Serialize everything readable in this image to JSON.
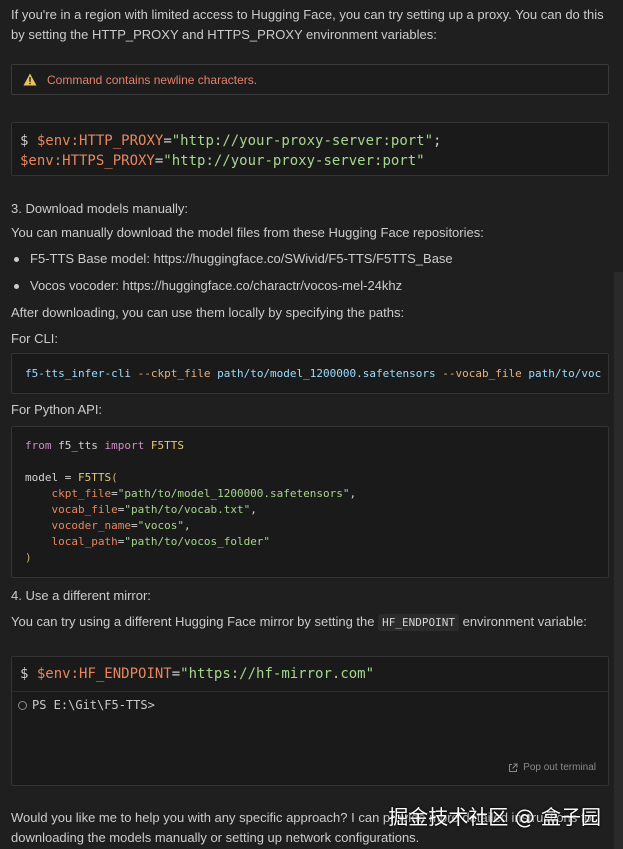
{
  "intro": "If you're in a region with limited access to Hugging Face, you can try setting up a proxy. You can do this by setting the HTTP_PROXY and HTTPS_PROXY environment variables:",
  "warning": {
    "icon": "warning-icon",
    "text": "Command contains newline characters."
  },
  "proxy_cmd": {
    "dollar": "$",
    "line1_var": "$env:HTTP_PROXY",
    "line1_eq": "=",
    "line1_str": "\"http://your-proxy-server:port\"",
    "line1_end": ";",
    "line2_var": "$env:HTTPS_PROXY",
    "line2_eq": "=",
    "line2_str": "\"http://your-proxy-server:port\""
  },
  "step3": {
    "heading": "3. Download models manually:",
    "desc": "You can manually download the model files from these Hugging Face repositories:",
    "bullets": [
      "F5-TTS Base model: https://huggingface.co/SWivid/F5-TTS/F5TTS_Base",
      "Vocos vocoder: https://huggingface.co/charactr/vocos-mel-24khz"
    ],
    "after": "After downloading, you can use them locally by specifying the paths:",
    "for_cli": "For CLI:",
    "cli_cmd": "f5-tts_infer-cli",
    "cli_flag1": "--ckpt_file",
    "cli_val1": "path/to/model_1200000.safetensors",
    "cli_flag2": "--vocab_file",
    "cli_val2": "path/to/voc",
    "for_python": "For Python API:"
  },
  "python": {
    "kw_from": "from",
    "module": "f5_tts",
    "kw_import": "import",
    "cls": "F5TTS",
    "model_var": "model",
    "eq": "=",
    "open": "(",
    "close": ")",
    "params": [
      {
        "name": "ckpt_file",
        "value": "\"path/to/model_1200000.safetensors\""
      },
      {
        "name": "vocab_file",
        "value": "\"path/to/vocab.txt\""
      },
      {
        "name": "vocoder_name",
        "value": "\"vocos\""
      },
      {
        "name": "local_path",
        "value": "\"path/to/vocos_folder\""
      }
    ]
  },
  "step4": {
    "heading": "4. Use a different mirror:",
    "desc_before": "You can try using a different Hugging Face mirror by setting the",
    "code": "HF_ENDPOINT",
    "desc_after": "environment variable:"
  },
  "terminal": {
    "dollar": "$",
    "var": "$env:HF_ENDPOINT",
    "eq": "=",
    "str": "\"https://hf-mirror.com\"",
    "prompt": "PS E:\\Git\\F5-TTS>",
    "popout_label": "Pop out terminal"
  },
  "footer": "Would you like me to help you with any specific approach? I can provide more detailed instructions for downloading the models manually or setting up network configurations.",
  "watermark": "掘金技术社区 @ 盒子园"
}
